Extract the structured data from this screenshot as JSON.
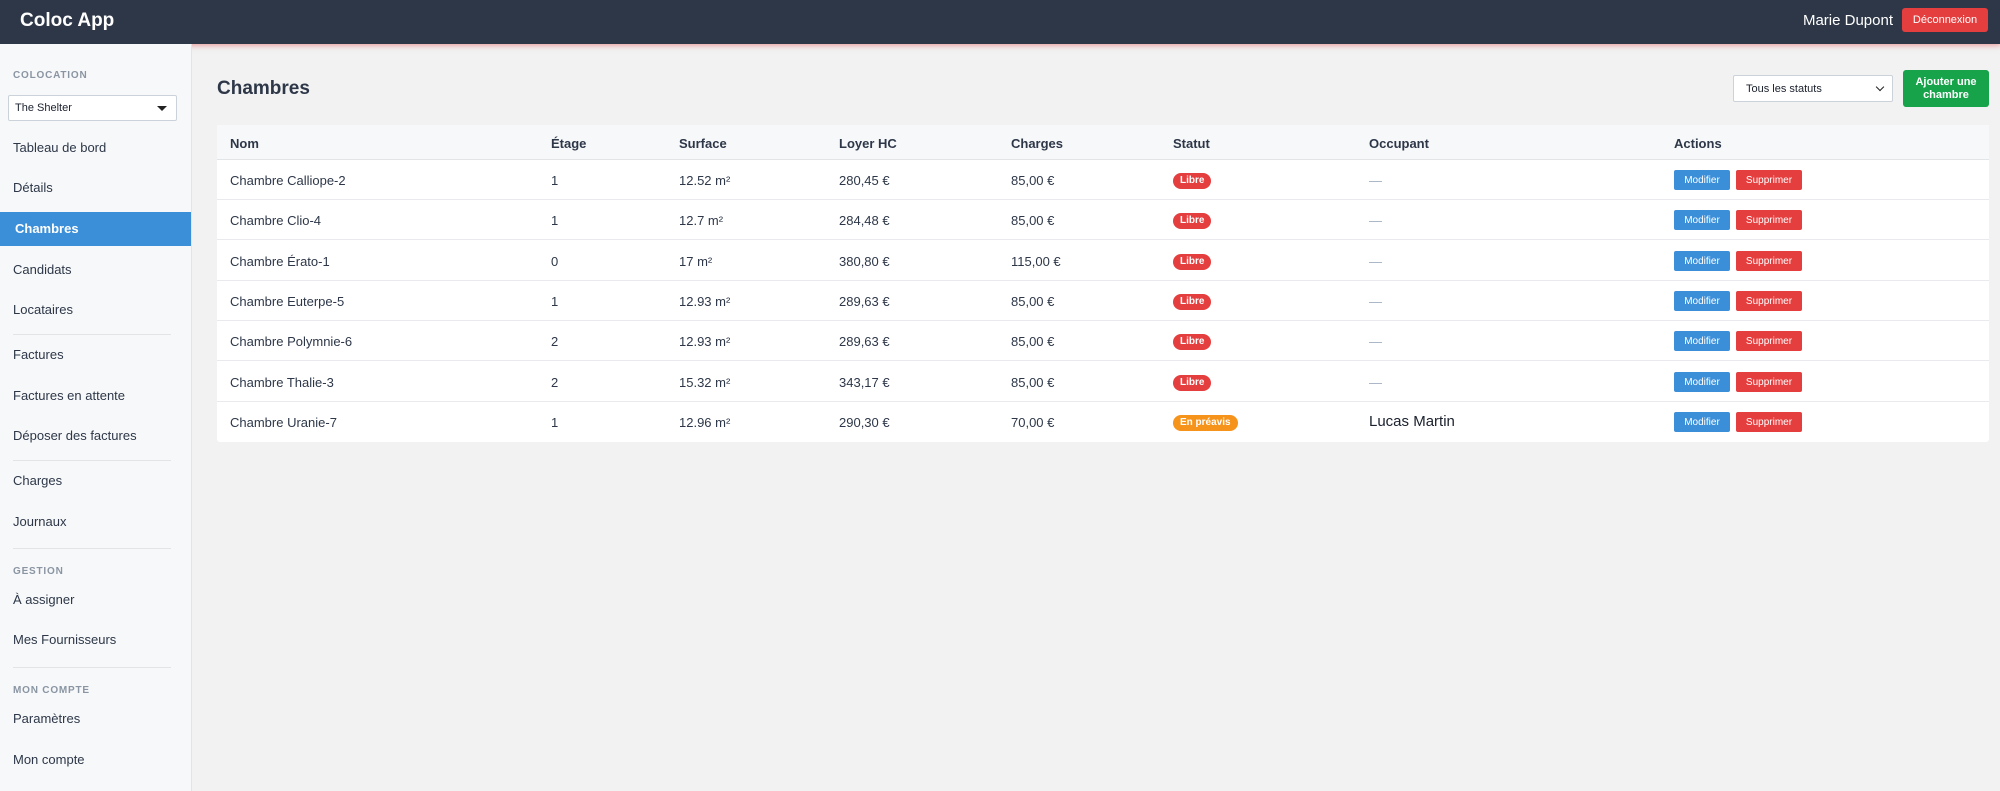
{
  "header": {
    "brand": "Coloc App",
    "user_name": "Marie Dupont",
    "logout_label": "Déconnexion"
  },
  "sidebar": {
    "colocation_section": "COLOCATION",
    "coloc_selected": "The Shelter",
    "items_group1": [
      {
        "label": "Tableau de bord"
      },
      {
        "label": "Détails"
      },
      {
        "label": "Chambres",
        "active": true
      },
      {
        "label": "Candidats"
      },
      {
        "label": "Locataires"
      }
    ],
    "items_group2": [
      {
        "label": "Factures"
      },
      {
        "label": "Factures en attente"
      },
      {
        "label": "Déposer des factures"
      }
    ],
    "items_group3": [
      {
        "label": "Charges"
      },
      {
        "label": "Journaux"
      }
    ],
    "gestion_section": "GESTION",
    "gestion_items": [
      {
        "label": "À assigner"
      },
      {
        "label": "Mes Fournisseurs"
      }
    ],
    "account_section": "MON COMPTE",
    "account_items": [
      {
        "label": "Paramètres"
      },
      {
        "label": "Mon compte"
      }
    ]
  },
  "main": {
    "title": "Chambres",
    "status_filter": "Tous les statuts",
    "add_button": "Ajouter une chambre",
    "table": {
      "columns": [
        "Nom",
        "Étage",
        "Surface",
        "Loyer HC",
        "Charges",
        "Statut",
        "Occupant",
        "Actions"
      ],
      "rows": [
        {
          "nom": "Chambre Calliope-2",
          "etage": "1",
          "surface": "12.52 m²",
          "loyer": "280,45 €",
          "charges": "85,00 €",
          "statut": "Libre",
          "occupant": "—"
        },
        {
          "nom": "Chambre Clio-4",
          "etage": "1",
          "surface": "12.7 m²",
          "loyer": "284,48 €",
          "charges": "85,00 €",
          "statut": "Libre",
          "occupant": "—"
        },
        {
          "nom": "Chambre Érato-1",
          "etage": "0",
          "surface": "17 m²",
          "loyer": "380,80 €",
          "charges": "115,00 €",
          "statut": "Libre",
          "occupant": "—"
        },
        {
          "nom": "Chambre Euterpe-5",
          "etage": "1",
          "surface": "12.93 m²",
          "loyer": "289,63 €",
          "charges": "85,00 €",
          "statut": "Libre",
          "occupant": "—"
        },
        {
          "nom": "Chambre Polymnie-6",
          "etage": "2",
          "surface": "12.93 m²",
          "loyer": "289,63 €",
          "charges": "85,00 €",
          "statut": "Libre",
          "occupant": "—"
        },
        {
          "nom": "Chambre Thalie-3",
          "etage": "2",
          "surface": "15.32 m²",
          "loyer": "343,17 €",
          "charges": "85,00 €",
          "statut": "Libre",
          "occupant": "—"
        },
        {
          "nom": "Chambre Uranie-7",
          "etage": "1",
          "surface": "12.96 m²",
          "loyer": "290,30 €",
          "charges": "70,00 €",
          "statut": "En préavis",
          "occupant": "Lucas Martin"
        }
      ],
      "edit_label": "Modifier",
      "delete_label": "Supprimer"
    }
  },
  "colors": {
    "topbar": "#2d3748",
    "primary": "#3b8fd9",
    "danger": "#e53e3e",
    "success": "#16a34a",
    "warning": "#f6931a"
  }
}
